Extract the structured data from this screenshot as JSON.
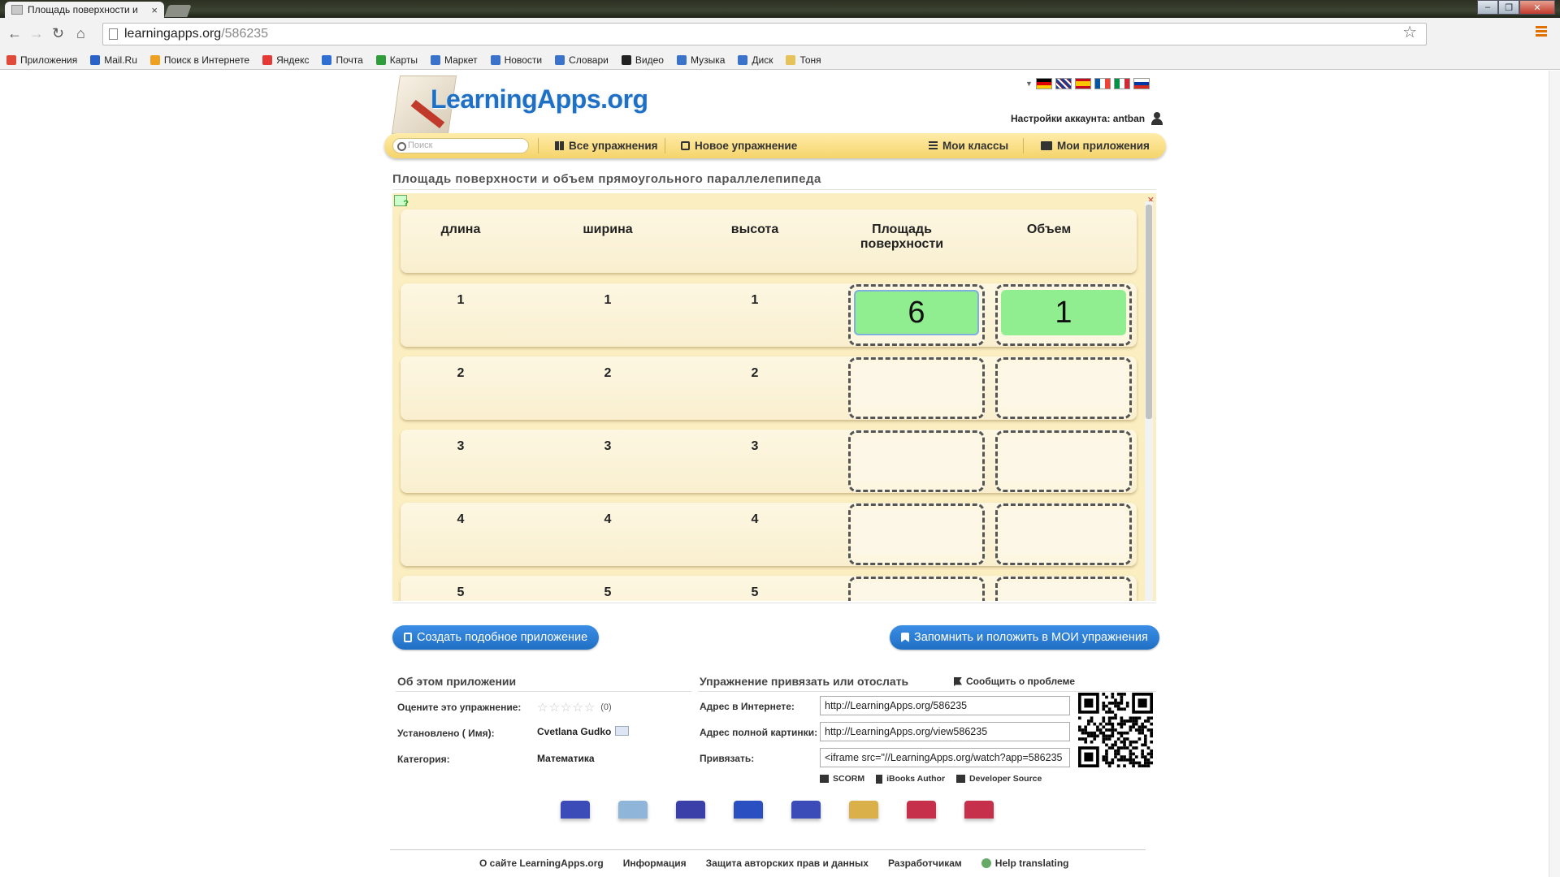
{
  "browser": {
    "tab_title": "Площадь поверхности и",
    "tab_close": "×",
    "url_host": "learningapps.org",
    "url_path": "/586235",
    "bookmarks": [
      {
        "label": "Приложения",
        "color": "#e04a3a"
      },
      {
        "label": "Mail.Ru",
        "color": "#2a62c9"
      },
      {
        "label": "Поиск в Интернете",
        "color": "#f0a020"
      },
      {
        "label": "Яндекс",
        "color": "#e53935"
      },
      {
        "label": "Почта",
        "color": "#2f6fd1"
      },
      {
        "label": "Карты",
        "color": "#2e9d3a"
      },
      {
        "label": "Маркет",
        "color": "#3a73c9"
      },
      {
        "label": "Новости",
        "color": "#3a73c9"
      },
      {
        "label": "Словари",
        "color": "#3a73c9"
      },
      {
        "label": "Видео",
        "color": "#222222"
      },
      {
        "label": "Музыка",
        "color": "#3a73c9"
      },
      {
        "label": "Диск",
        "color": "#3a73c9"
      },
      {
        "label": "Тоня",
        "color": "#e6c25a"
      }
    ]
  },
  "header": {
    "logo": "LearningApps.org",
    "account_label": "Настройки аккаунта: antban",
    "flags": [
      "de",
      "en",
      "es",
      "fr",
      "it",
      "ru"
    ],
    "search_placeholder": "Поиск",
    "menu": {
      "all": "Все упражнения",
      "new": "Новое упражнение",
      "classes": "Мои классы",
      "apps": "Мои приложения"
    }
  },
  "app": {
    "title": "Площадь поверхности и объем прямоугольного параллелепипеда",
    "columns": [
      "длина",
      "ширина",
      "высота",
      "Площадь поверхности",
      "Объем"
    ],
    "rows": [
      {
        "length": "1",
        "width": "1",
        "height": "1",
        "area": "6",
        "volume": "1"
      },
      {
        "length": "2",
        "width": "2",
        "height": "2",
        "area": "",
        "volume": ""
      },
      {
        "length": "3",
        "width": "3",
        "height": "3",
        "area": "",
        "volume": ""
      },
      {
        "length": "4",
        "width": "4",
        "height": "4",
        "area": "",
        "volume": ""
      },
      {
        "length": "5",
        "width": "5",
        "height": "5",
        "area": "",
        "volume": ""
      }
    ]
  },
  "actions": {
    "create_similar": "Создать подобное приложение",
    "save_to_mine": "Запомнить и положить в МОИ упражнения"
  },
  "about": {
    "heading": "Об этом приложении",
    "rate_label": "Оцените это упражнение:",
    "rating_count": "(0)",
    "author_label": "Установлено ( Имя):",
    "author": "Cvetlana Gudko",
    "category_label": "Категория:",
    "category": "Математика"
  },
  "share": {
    "heading": "Упражнение привязать или отослать",
    "report": "Сообщить о проблеме",
    "web_label": "Адрес в Интернете:",
    "web_value": "http://LearningApps.org/586235",
    "image_label": "Адрес полной картинки:",
    "image_value": "http://LearningApps.org/view586235",
    "embed_label": "Привязать:",
    "embed_value": "<iframe src=\"//LearningApps.org/watch?app=586235",
    "scorm": "SCORM",
    "ibooks": "iBooks Author",
    "developer": "Developer Source",
    "social_icons": [
      {
        "name": "email-icon",
        "color": "#3b4bb8"
      },
      {
        "name": "twitter-icon",
        "color": "#8fb5d8"
      },
      {
        "name": "facebook-icon",
        "color": "#3b3fa8"
      },
      {
        "name": "delicious-icon",
        "color": "#2a4fc0"
      },
      {
        "name": "myspace-icon",
        "color": "#3b4bb8"
      },
      {
        "name": "google-icon",
        "color": "#d9b04a"
      },
      {
        "name": "pinterest-icon",
        "color": "#c7304a"
      },
      {
        "name": "googleplus-icon",
        "color": "#c7304a"
      }
    ]
  },
  "footer": {
    "about": "О сайте LearningApps.org",
    "info": "Информация",
    "copyright": "Защита авторских прав и данных",
    "developers": "Разработчикам",
    "translate": "Help translating"
  }
}
